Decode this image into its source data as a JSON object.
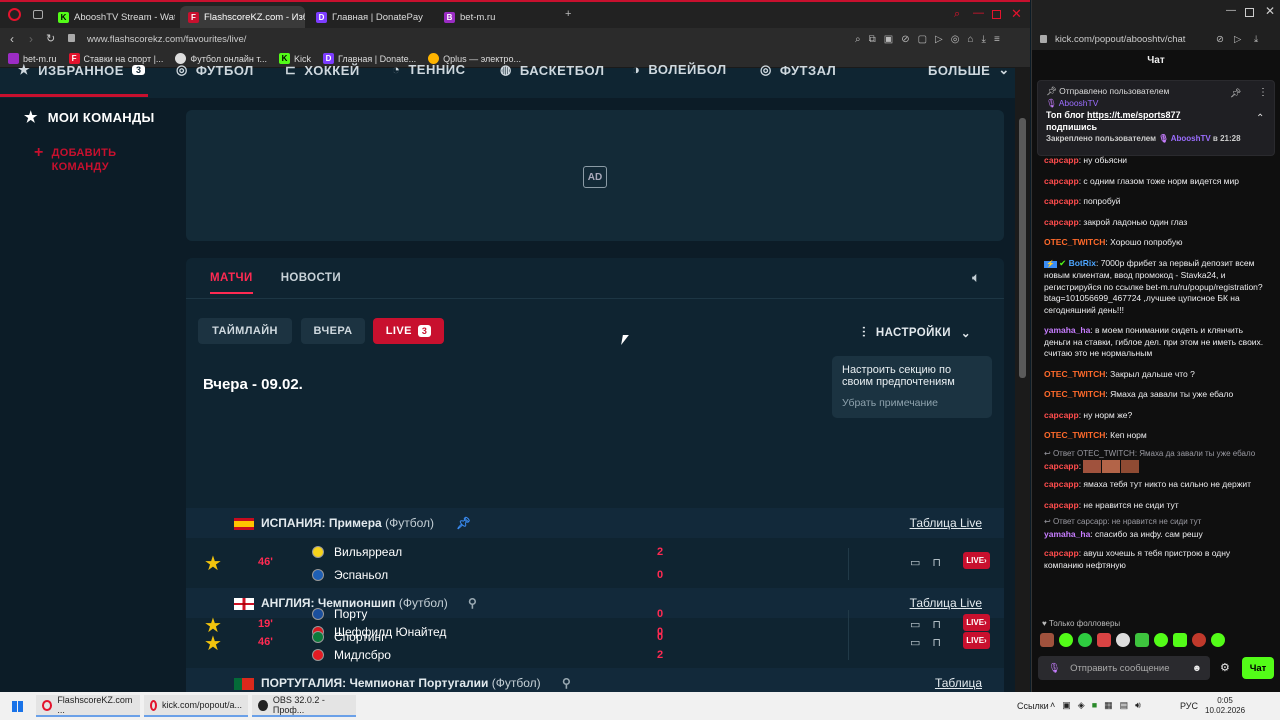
{
  "browser_left": {
    "tabs": [
      {
        "label": "AbooshTV Stream - Watch",
        "icon": "kick-icon",
        "color": "#53fc18"
      },
      {
        "label": "FlashscoreKZ.com - Избр",
        "icon": "flashscore-icon",
        "color": "#c8102e",
        "active": true
      },
      {
        "label": "Главная | DonatePay",
        "icon": "donatepay-icon",
        "color": "#7d3cff"
      },
      {
        "label": "bet-m.ru",
        "icon": "betm-icon",
        "color": "#9b2cc4"
      }
    ],
    "url": "www.flashscorekz.com/favourites/live/",
    "bookmarks": [
      {
        "label": "bet-m.ru"
      },
      {
        "label": "Ставки на спорт |..."
      },
      {
        "label": "Футбол онлайн т..."
      },
      {
        "label": "Kick"
      },
      {
        "label": "Главная | Donate..."
      },
      {
        "label": "Qplus — электро..."
      }
    ]
  },
  "site": {
    "nav": [
      "ИЗБРАННОЕ",
      "ФУТБОЛ",
      "ХОККЕЙ",
      "ТЕННИС",
      "БАСКЕТБОЛ",
      "ВОЛЕЙБОЛ",
      "ФУТЗАЛ",
      "БОЛЬШЕ"
    ],
    "nav_badge": "3",
    "my_teams": "МОИ КОМАНДЫ",
    "add_team_1": "ДОБАВИТЬ",
    "add_team_2": "КОМАНДУ",
    "ad_label": "AD",
    "tabs": [
      "МАТЧИ",
      "НОВОСТИ"
    ],
    "filters": {
      "timeline": "ТАЙМЛАЙН",
      "yesterday": "ВЧЕРА",
      "live": "LIVE",
      "live_count": "3"
    },
    "settings": "НАСТРОЙКИ",
    "date_header": "Вчера - 09.02.",
    "tooltip": {
      "text": "Настроить секцию по своим предпочтениям",
      "dismiss": "Убрать примечание"
    },
    "leagues": [
      {
        "country": "ИСПАНИЯ",
        "name": "Примера",
        "sport": "(Футбол)",
        "table": "Таблица Live",
        "pinned": true,
        "match": {
          "minute": "46'",
          "home": "Вильярреал",
          "away": "Эспаньол",
          "home_score": "2",
          "away_score": "0",
          "live": "LIVE"
        }
      },
      {
        "country": "АНГЛИЯ",
        "name": "Чемпионшип",
        "sport": "(Футбол)",
        "table": "Таблица Live",
        "pinned": false,
        "match": {
          "minute": "46'",
          "home": "Шеффилд Юнайтед",
          "away": "Мидлсбро",
          "home_score": "0",
          "away_score": "2",
          "live": "LIVE"
        }
      },
      {
        "country": "ПОРТУГАЛИЯ",
        "name": "Чемпионат Португалии",
        "sport": "(Футбол)",
        "table": "Таблица",
        "pinned": false,
        "match": {
          "minute": "19'",
          "home": "Порту",
          "away": "Спортинг",
          "home_score": "0",
          "away_score": "0",
          "live": "LIVE"
        }
      }
    ]
  },
  "chat": {
    "url": "kick.com/popout/abooshtv/chat",
    "title": "Чат",
    "pinned": {
      "header": "Отправлено пользователем",
      "author": "AbooshTV",
      "text_prefix": "Топ блог ",
      "link": "https://t.me/sports877",
      "text_suffix": "подпишись",
      "footer_prefix": "Закреплено пользователем",
      "footer_user": "AbooshTV",
      "footer_time": "в 21:28"
    },
    "messages": [
      {
        "user": "сарсарр",
        "color": "#ff4d4d",
        "text": ": ну обьясни"
      },
      {
        "user": "сарсарр",
        "color": "#ff4d4d",
        "text": ": с одним глазом тоже норм видется мир"
      },
      {
        "user": "сарсарр",
        "color": "#ff4d4d",
        "text": ": попробуй"
      },
      {
        "user": "сарсарр",
        "color": "#ff4d4d",
        "text": ": закрой ладонью один глаз"
      },
      {
        "user": "OTEC_TWITCH",
        "color": "#ff6a2b",
        "text": ": Хорошо попробую"
      },
      {
        "user": "BotRix",
        "color": "#4da6ff",
        "text": ": 7000р фрибет за первый депозит всем новым клиентам, ввод промокод - Stavka24, и регистрируйся по ссылке bet-m.ru/ru/popup/registration?btag=101056699_467724 ,лучшее цуписное БК на сегодняшний день!!!"
      },
      {
        "user": "yamaha_ha",
        "color": "#c77dff",
        "text": ": в моем понимании сидеть и клянчить деньги на ставки, гиблое дел. при этом не иметь своих. считаю это не нормальным"
      },
      {
        "user": "OTEC_TWITCH",
        "color": "#ff6a2b",
        "text": ": Закрыл дальше что ?"
      },
      {
        "user": "OTEC_TWITCH",
        "color": "#ff6a2b",
        "text": ": Ямаха да завали ты уже ебало"
      },
      {
        "user": "сарсарр",
        "color": "#ff4d4d",
        "text": ": ну норм же?"
      },
      {
        "user": "OTEC_TWITCH",
        "color": "#ff6a2b",
        "text": ": Кеп норм"
      },
      {
        "reply": "Ответ OTEC_TWITCH: Ямаха да завали ты уже ебало",
        "user": "сарсарр",
        "color": "#ff4d4d",
        "text": ":",
        "emotes": true
      },
      {
        "user": "сарсарр",
        "color": "#ff4d4d",
        "text": ": ямаха тебя тут никто на сильно не держит"
      },
      {
        "user": "сарсарр",
        "color": "#ff4d4d",
        "text": ": не нравится не сиди тут"
      },
      {
        "reply": "Ответ сарсарр: не нравится не сиди тут",
        "user": "yamaha_ha",
        "color": "#c77dff",
        "text": ": спасибо за инфу. сам решу"
      },
      {
        "user": "сарсарр",
        "color": "#ff4d4d",
        "text": ": авуш хочешь я тебя пристрою в одну компанию нефтяную"
      }
    ],
    "followers_only": "Только фолловеры",
    "input_placeholder": "Отправить сообщение",
    "send": "Чат"
  },
  "taskbar": {
    "apps": [
      "FlashscoreKZ.com ...",
      "kick.com/popout/a...",
      "OBS 32.0.2 - Проф..."
    ],
    "links": "Ссылки",
    "lang": "РУС",
    "time": "0:05",
    "date": "10.02.2026"
  }
}
